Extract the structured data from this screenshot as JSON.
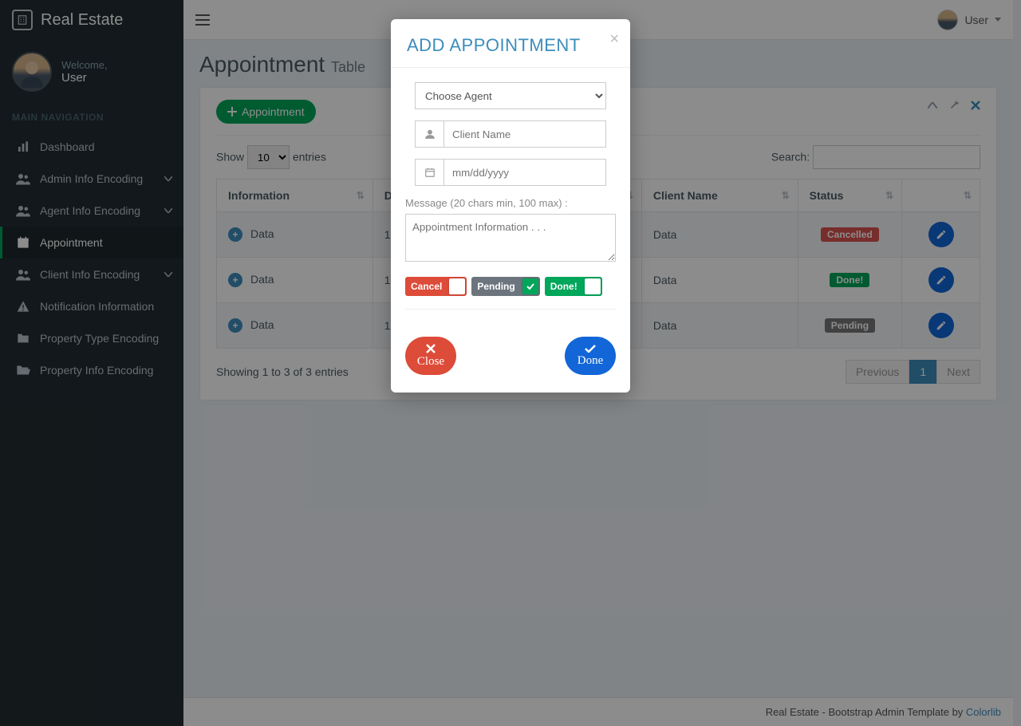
{
  "brand": "Real Estate",
  "user_panel": {
    "welcome": "Welcome,",
    "name": "User"
  },
  "nav_header": "MAIN NAVIGATION",
  "sidebar": {
    "items": [
      {
        "label": "Dashboard",
        "icon": "bar-chart-icon",
        "expandable": false
      },
      {
        "label": "Admin Info Encoding",
        "icon": "users-icon",
        "expandable": true
      },
      {
        "label": "Agent Info Encoding",
        "icon": "users-icon",
        "expandable": true
      },
      {
        "label": "Appointment",
        "icon": "calendar-icon",
        "expandable": false,
        "active": true
      },
      {
        "label": "Client Info Encoding",
        "icon": "users-icon",
        "expandable": true
      },
      {
        "label": "Notification Information",
        "icon": "warning-icon",
        "expandable": false
      },
      {
        "label": "Property Type Encoding",
        "icon": "folder-icon",
        "expandable": false
      },
      {
        "label": "Property Info Encoding",
        "icon": "folder-open-icon",
        "expandable": false
      }
    ]
  },
  "topbar": {
    "user_label": "User"
  },
  "page": {
    "title": "Appointment",
    "subtitle": "Table"
  },
  "panel": {
    "add_button": "Appointment"
  },
  "datatable": {
    "show_label": "Show",
    "entries_label": "entries",
    "page_size": "10",
    "search_label": "Search:",
    "columns": [
      "Information",
      "D",
      "",
      "Client Name",
      "Status",
      ""
    ],
    "rows": [
      {
        "info": "Data",
        "col2": "1",
        "client": "Data",
        "status": "Cancelled",
        "status_class": "cancelled"
      },
      {
        "info": "Data",
        "col2": "1",
        "client": "Data",
        "status": "Done!",
        "status_class": "done"
      },
      {
        "info": "Data",
        "col2": "1",
        "client": "Data",
        "status": "Pending",
        "status_class": "pending"
      }
    ],
    "info_text": "Showing 1 to 3 of 3 entries",
    "prev": "Previous",
    "page_num": "1",
    "next": "Next"
  },
  "footer": {
    "text": "Real Estate - Bootstrap Admin Template by ",
    "link": "Colorlib"
  },
  "modal": {
    "title": "ADD APPOINTMENT",
    "agent_placeholder": "Choose Agent",
    "client_placeholder": "Client Name",
    "date_placeholder": "mm/dd/yyyy",
    "message_label": "Message (20 chars min, 100 max) :",
    "message_placeholder": "Appointment Information . . .",
    "toggles": {
      "cancel": "Cancel",
      "pending": "Pending",
      "done": "Done!"
    },
    "close_btn": "Close",
    "done_btn": "Done"
  }
}
